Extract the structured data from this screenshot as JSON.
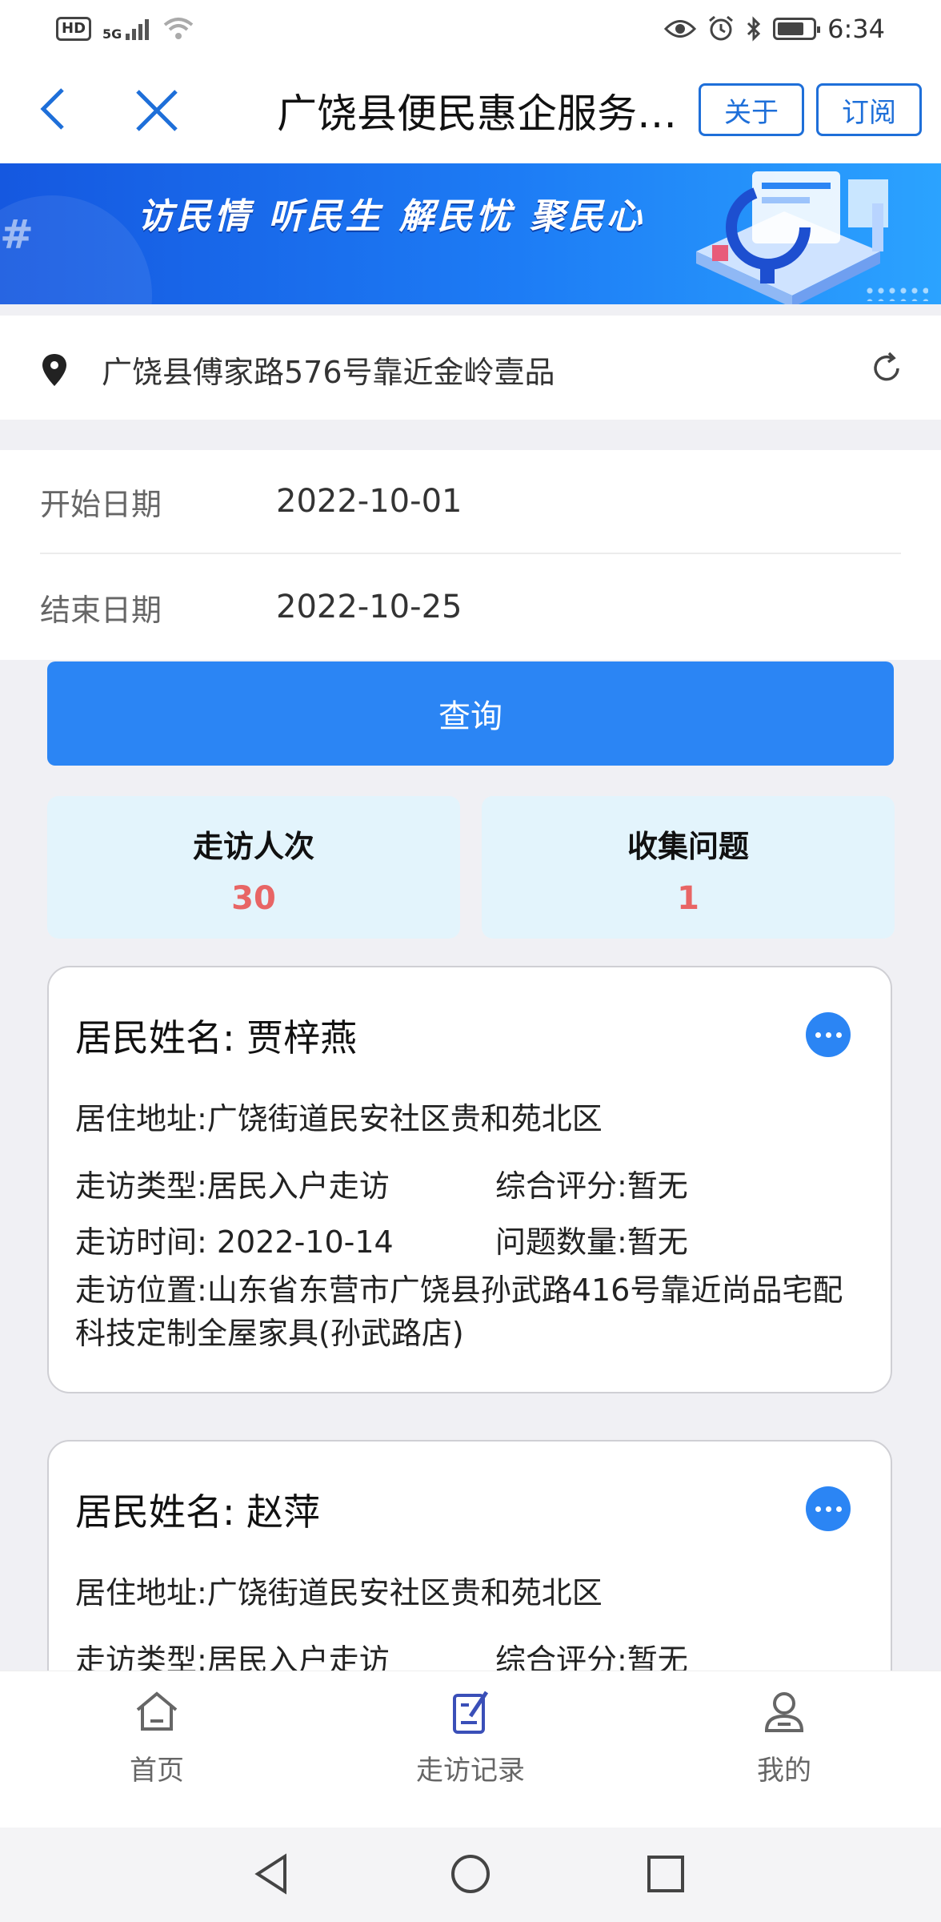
{
  "status_bar": {
    "hd": "HD",
    "network": "5G",
    "time": "6:34",
    "battery_level": 0.75
  },
  "nav": {
    "title": "广饶县便民惠企服务平台",
    "about_label": "关于",
    "subscribe_label": "订阅"
  },
  "banner": {
    "slogan": "访民情  听民生  解民忧  聚民心"
  },
  "location": {
    "address": "广饶县傅家路576号靠近金岭壹品"
  },
  "filters": {
    "start_label": "开始日期",
    "start_value": "2022-10-01",
    "end_label": "结束日期",
    "end_value": "2022-10-25",
    "query_label": "查询"
  },
  "stats": {
    "visits_label": "走访人次",
    "visits_value": "30",
    "issues_label": "收集问题",
    "issues_value": "1"
  },
  "records": [
    {
      "name": "居民姓名:  贾梓燕",
      "address": "居住地址:广饶街道民安社区贵和苑北区",
      "visit_type": "走访类型:居民入户走访",
      "rating": "综合评分:暂无",
      "visit_time": "走访时间: 2022-10-14",
      "issue_count": "问题数量:暂无",
      "visit_location": "走访位置:山东省东营市广饶县孙武路416号靠近尚品宅配科技定制全屋家具(孙武路店)"
    },
    {
      "name": "居民姓名:  赵萍",
      "address": "居住地址:广饶街道民安社区贵和苑北区",
      "visit_type": "走访类型:居民入户走访",
      "rating": "综合评分:暂无"
    }
  ],
  "tabs": {
    "home": "首页",
    "records": "走访记录",
    "mine": "我的"
  },
  "colors": {
    "primary": "#2b85f4",
    "stat_value": "#e86565",
    "stat_bg": "#e3f4fc"
  }
}
